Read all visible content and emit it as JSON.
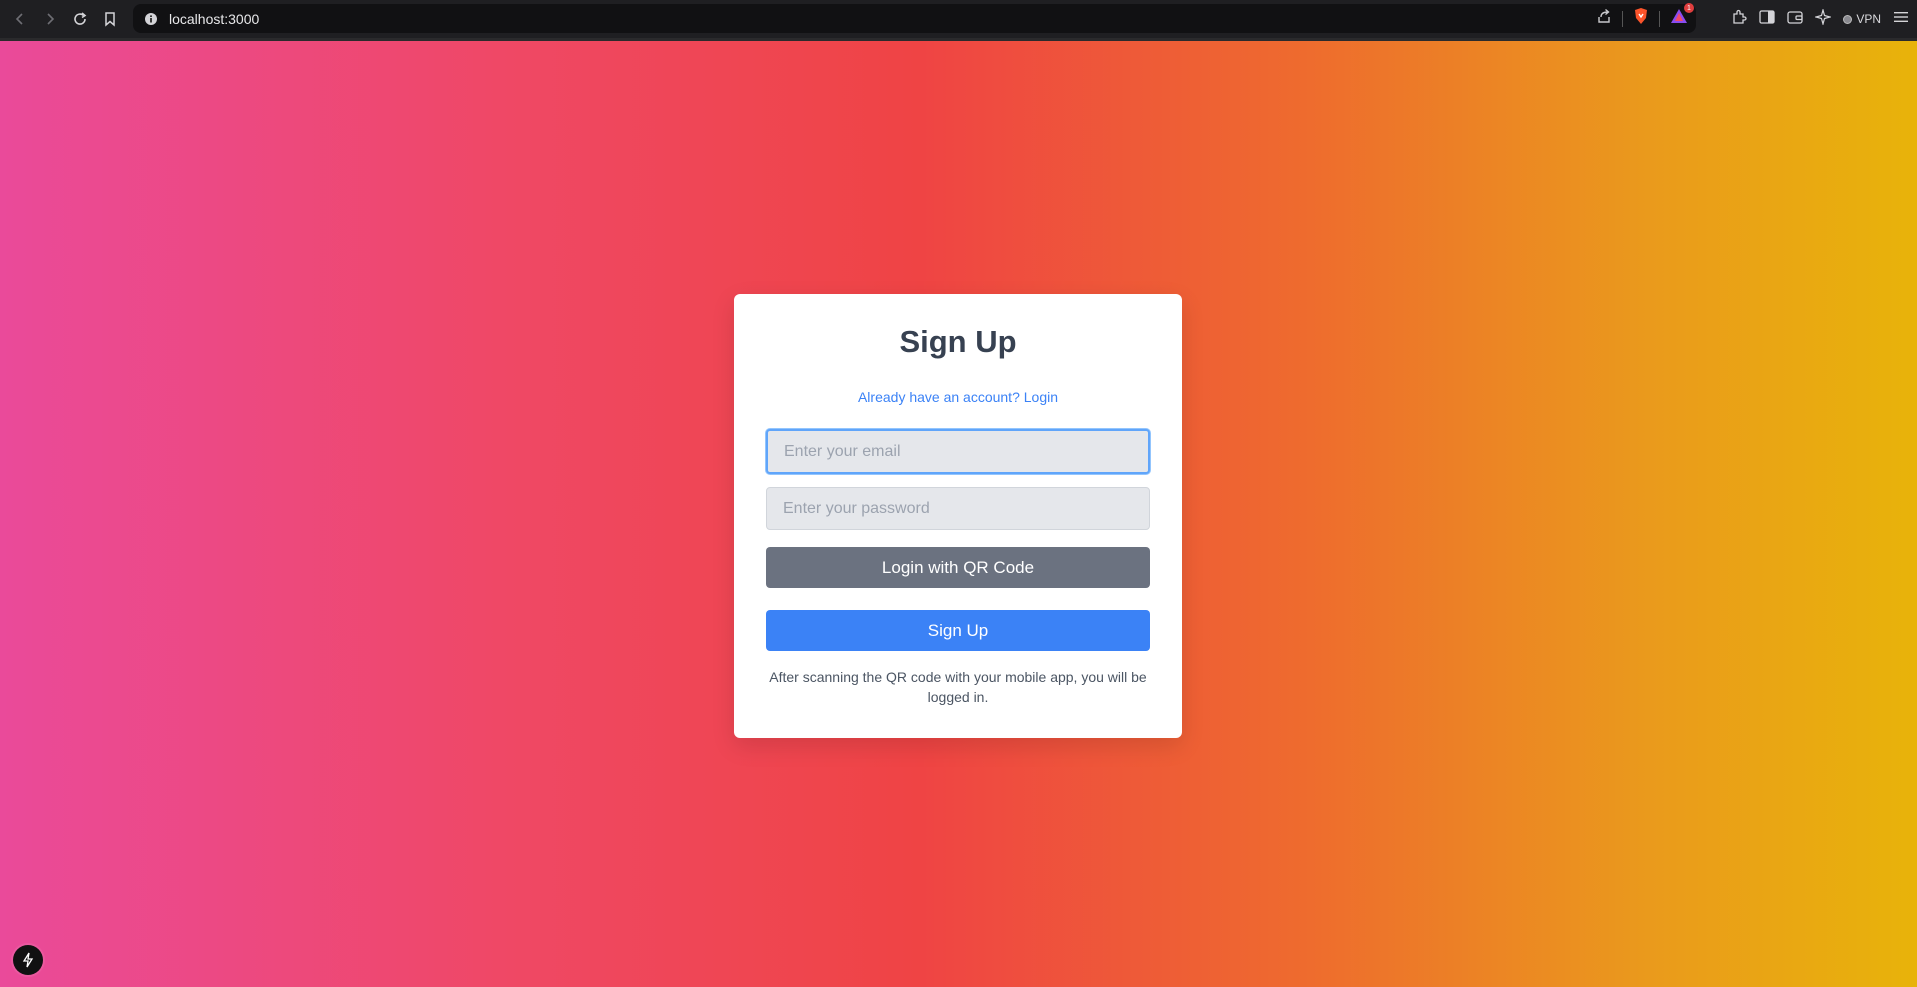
{
  "browser": {
    "url": "localhost:3000",
    "vpn_label": "VPN",
    "notification_count": "1"
  },
  "signup": {
    "title": "Sign Up",
    "login_link": "Already have an account? Login",
    "email_placeholder": "Enter your email",
    "password_placeholder": "Enter your password",
    "qr_button": "Login with QR Code",
    "signup_button": "Sign Up",
    "hint": "After scanning the QR code with your mobile app, you will be logged in."
  },
  "colors": {
    "primary": "#3b82f6",
    "secondary": "#6b7280",
    "gradient_start": "#ea4a9a",
    "gradient_mid": "#ef4444",
    "gradient_end": "#e8b30a"
  },
  "icons": [
    "back-icon",
    "forward-icon",
    "reload-icon",
    "bookmark-icon",
    "info-icon",
    "share-icon",
    "brave-shield-icon",
    "brave-rewards-icon",
    "extensions-icon",
    "sidebar-icon",
    "wallet-icon",
    "leo-ai-icon",
    "menu-icon",
    "lightning-icon"
  ]
}
